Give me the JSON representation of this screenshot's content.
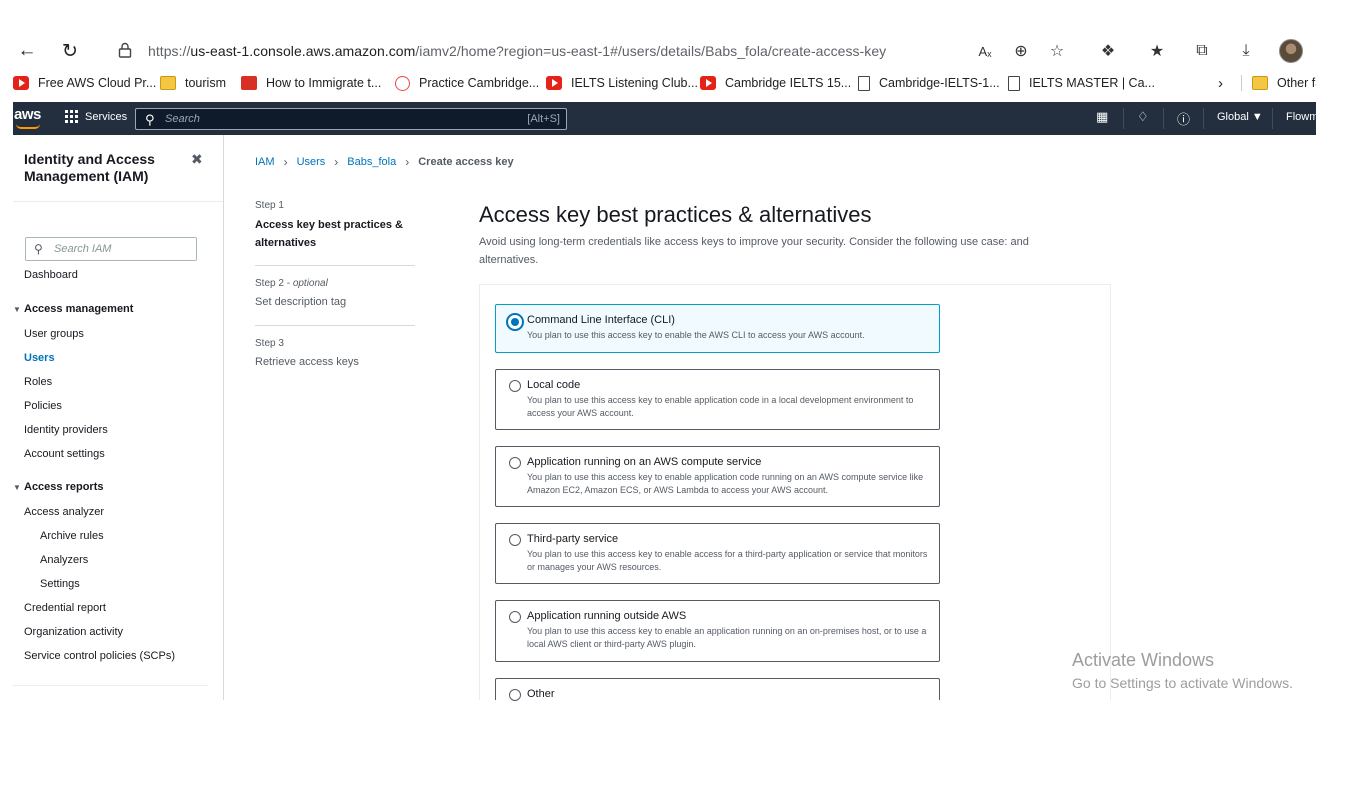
{
  "browser": {
    "url_prefix": "https://",
    "url_domain": "us-east-1.console.aws.amazon.com",
    "url_path": "/iamv2/home?region=us-east-1#/users/details/Babs_fola/create-access-key",
    "bookmarks": [
      {
        "label": "Free AWS Cloud Pr...",
        "icon": "youtube-icon"
      },
      {
        "label": "tourism",
        "icon": "folder-icon"
      },
      {
        "label": "How to Immigrate t...",
        "icon": "maple-leaf-icon"
      },
      {
        "label": "Practice Cambridge...",
        "icon": "site-icon"
      },
      {
        "label": "IELTS Listening Club...",
        "icon": "youtube-icon"
      },
      {
        "label": "Cambridge IELTS 15...",
        "icon": "youtube-icon"
      },
      {
        "label": "Cambridge-IELTS-1...",
        "icon": "document-icon"
      },
      {
        "label": "IELTS MASTER | Ca...",
        "icon": "document-icon"
      },
      {
        "label": "Other fa",
        "icon": "folder-icon"
      }
    ]
  },
  "awsnav": {
    "logo": "aws",
    "services": "Services",
    "search_placeholder": "Search",
    "search_shortcut": "[Alt+S]",
    "region": "Global ▼",
    "account": "Flowm"
  },
  "sidebar": {
    "title": "Identity and Access Management (IAM)",
    "search_placeholder": "Search IAM",
    "dashboard": "Dashboard",
    "access_management": "Access management",
    "user_groups": "User groups",
    "users": "Users",
    "roles": "Roles",
    "policies": "Policies",
    "identity_providers": "Identity providers",
    "account_settings": "Account settings",
    "access_reports": "Access reports",
    "access_analyzer": "Access analyzer",
    "archive_rules": "Archive rules",
    "analyzers": "Analyzers",
    "settings": "Settings",
    "credential_report": "Credential report",
    "organization_activity": "Organization activity",
    "scps": "Service control policies (SCPs)"
  },
  "breadcrumb": {
    "iam": "IAM",
    "users": "Users",
    "user": "Babs_fola",
    "current": "Create access key"
  },
  "steps": [
    {
      "num": "Step 1",
      "optional": "",
      "name": "Access key best practices & alternatives"
    },
    {
      "num": "Step 2 - ",
      "optional": "optional",
      "name": "Set description tag"
    },
    {
      "num": "Step 3",
      "optional": "",
      "name": "Retrieve access keys"
    }
  ],
  "main": {
    "title": "Access key best practices & alternatives",
    "description": "Avoid using long-term credentials like access keys to improve your security. Consider the following use case: and alternatives.",
    "options": [
      {
        "title": "Command Line Interface (CLI)",
        "desc": "You plan to use this access key to enable the AWS CLI to access your AWS account.",
        "selected": true
      },
      {
        "title": "Local code",
        "desc": "You plan to use this access key to enable application code in a local development environment to access your AWS account.",
        "selected": false
      },
      {
        "title": "Application running on an AWS compute service",
        "desc": "You plan to use this access key to enable application code running on an AWS compute service like Amazon EC2, Amazon ECS, or AWS Lambda to access your AWS account.",
        "selected": false
      },
      {
        "title": "Third-party service",
        "desc": "You plan to use this access key to enable access for a third-party application or service that monitors or manages your AWS resources.",
        "selected": false
      },
      {
        "title": "Application running outside AWS",
        "desc": "You plan to use this access key to enable an application running on an on-premises host, or to use a local AWS client or third-party AWS plugin.",
        "selected": false
      },
      {
        "title": "Other",
        "desc": "",
        "selected": false
      }
    ]
  },
  "watermark": {
    "line1": "Activate Windows",
    "line2": "Go to Settings to activate Windows."
  },
  "colors": {
    "aws_nav": "#232f3e",
    "link": "#0073bb",
    "selected_border": "#00a1c9",
    "selected_bg": "#f1faff"
  }
}
